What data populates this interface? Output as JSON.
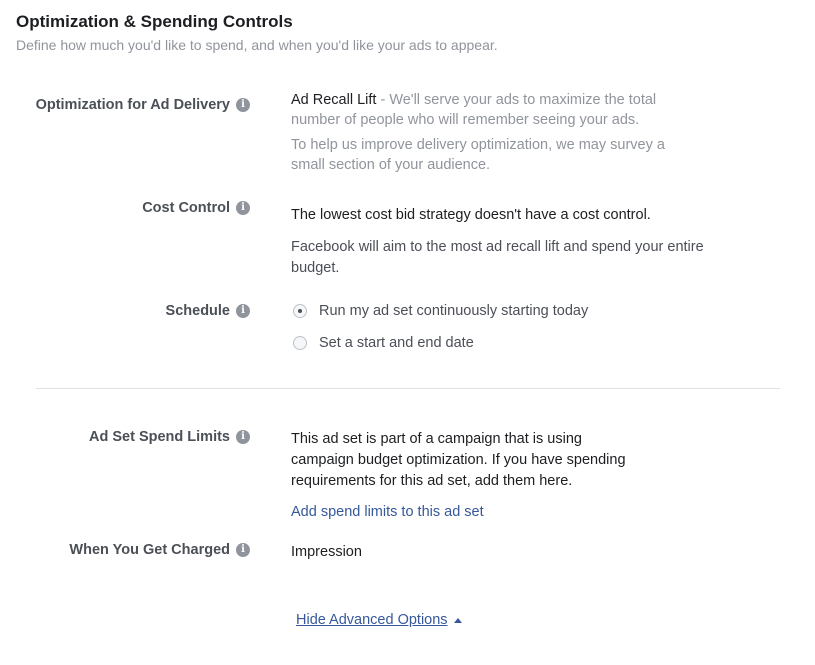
{
  "section": {
    "title": "Optimization & Spending Controls",
    "subtitle": "Define how much you'd like to spend, and when you'd like your ads to appear."
  },
  "optimization": {
    "label": "Optimization for Ad Delivery",
    "value": "Ad Recall Lift",
    "description_line1": " - We'll serve your ads to maximize the total",
    "description_line2": "number of people who will remember seeing your ads.",
    "note_line1": "To help us improve delivery optimization, we may survey a",
    "note_line2": "small section of your audience."
  },
  "cost_control": {
    "label": "Cost Control",
    "line1": "The lowest cost bid strategy doesn't have a cost control.",
    "line2a": "Facebook will aim to the most ad recall lift and spend your entire",
    "line2b": "budget."
  },
  "schedule": {
    "label": "Schedule",
    "options": [
      {
        "label": "Run my ad set continuously starting today",
        "selected": true
      },
      {
        "label": "Set a start and end date",
        "selected": false
      }
    ]
  },
  "spend_limits": {
    "label": "Ad Set Spend Limits",
    "line1": "This ad set is part of a campaign that is using",
    "line2": "campaign budget optimization. If you have spending",
    "line3": "requirements for this ad set, add them here.",
    "link": "Add spend limits to this ad set"
  },
  "charged": {
    "label": "When You Get Charged",
    "value": "Impression"
  },
  "footer": {
    "hide_advanced": "Hide Advanced Options"
  },
  "icons": {
    "info": "info-icon",
    "caret": "caret-up-icon"
  },
  "colors": {
    "link": "#365899",
    "muted": "#90949c",
    "label": "#4b4f56",
    "divider": "#dddfe2"
  }
}
